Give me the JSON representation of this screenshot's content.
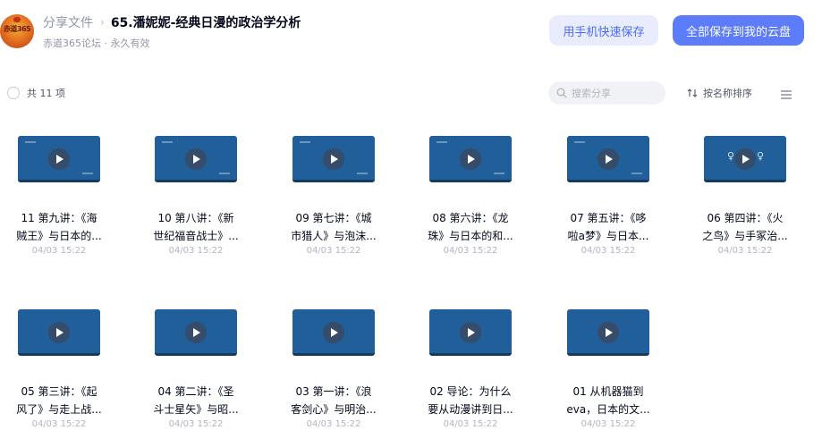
{
  "header": {
    "avatar_text": "赤道365",
    "breadcrumb_root": "分享文件",
    "breadcrumb_sep": "›",
    "title": "65.潘妮妮-经典日漫的政治学分析",
    "subline": "赤道365论坛 · 永久有效",
    "save_mobile_label": "用手机快速保存",
    "save_all_label": "全部保存到我的云盘"
  },
  "toolbar": {
    "count_label": "共 11 项",
    "search_placeholder": "搜索分享",
    "sort_label": "按名称排序"
  },
  "files": [
    {
      "line1": "11 第九讲：《海",
      "line2": "贼王》与日本的...",
      "date": "04/03 15:22"
    },
    {
      "line1": "10 第八讲：《新",
      "line2": "世纪福音战士》...",
      "date": "04/03 15:22"
    },
    {
      "line1": "09 第七讲：《城",
      "line2": "市猎人》与泡沫...",
      "date": "04/03 15:22"
    },
    {
      "line1": "08 第六讲：《龙",
      "line2": "珠》与日本的和...",
      "date": "04/03 15:22"
    },
    {
      "line1": "07 第五讲：《哆",
      "line2": "啦a梦》与日本...",
      "date": "04/03 15:22"
    },
    {
      "line1": "06 第四讲：《火",
      "line2": "之鸟》与手冢治...",
      "date": "04/03 15:22"
    },
    {
      "line1": "05 第三讲：《起",
      "line2": "风了》与走上战...",
      "date": "04/03 15:22"
    },
    {
      "line1": "04 第二讲：《圣",
      "line2": "斗士星矢》与昭...",
      "date": "04/03 15:22"
    },
    {
      "line1": "03 第一讲：《浪",
      "line2": "客剑心》与明治...",
      "date": "04/03 15:22"
    },
    {
      "line1": "02 导论：为什么",
      "line2": "要从动漫讲到日...",
      "date": "04/03 15:22"
    },
    {
      "line1": "01 从机器猫到",
      "line2": "eva，日本的文...",
      "date": "04/03 15:22"
    }
  ]
}
